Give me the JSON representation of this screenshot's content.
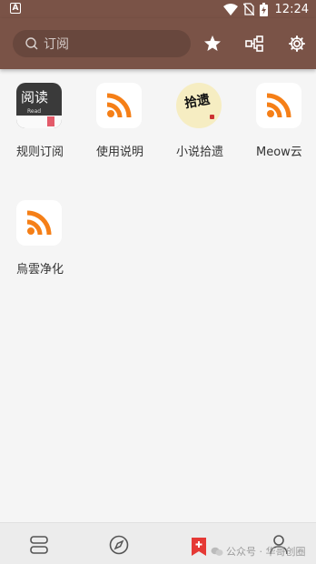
{
  "status_bar": {
    "app_icon": "A",
    "time": "12:24"
  },
  "toolbar": {
    "search_placeholder": "订阅"
  },
  "sources": [
    {
      "label": "规则订阅",
      "icon": "yuedu-app-icon",
      "icon_text": "阅读",
      "icon_subtext": "Read"
    },
    {
      "label": "使用说明",
      "icon": "rss-icon"
    },
    {
      "label": "小说拾遗",
      "icon": "shiyi-logo-icon",
      "icon_text": "拾遗"
    },
    {
      "label": "Meow云",
      "icon": "rss-icon"
    },
    {
      "label": "烏雲净化",
      "icon": "rss-icon"
    }
  ],
  "colors": {
    "toolbar": "#7a5347",
    "rss_orange": "#f57f17",
    "bottom_active": "#e53935"
  },
  "watermark": {
    "text": "公众号 · 华哥创圈"
  }
}
